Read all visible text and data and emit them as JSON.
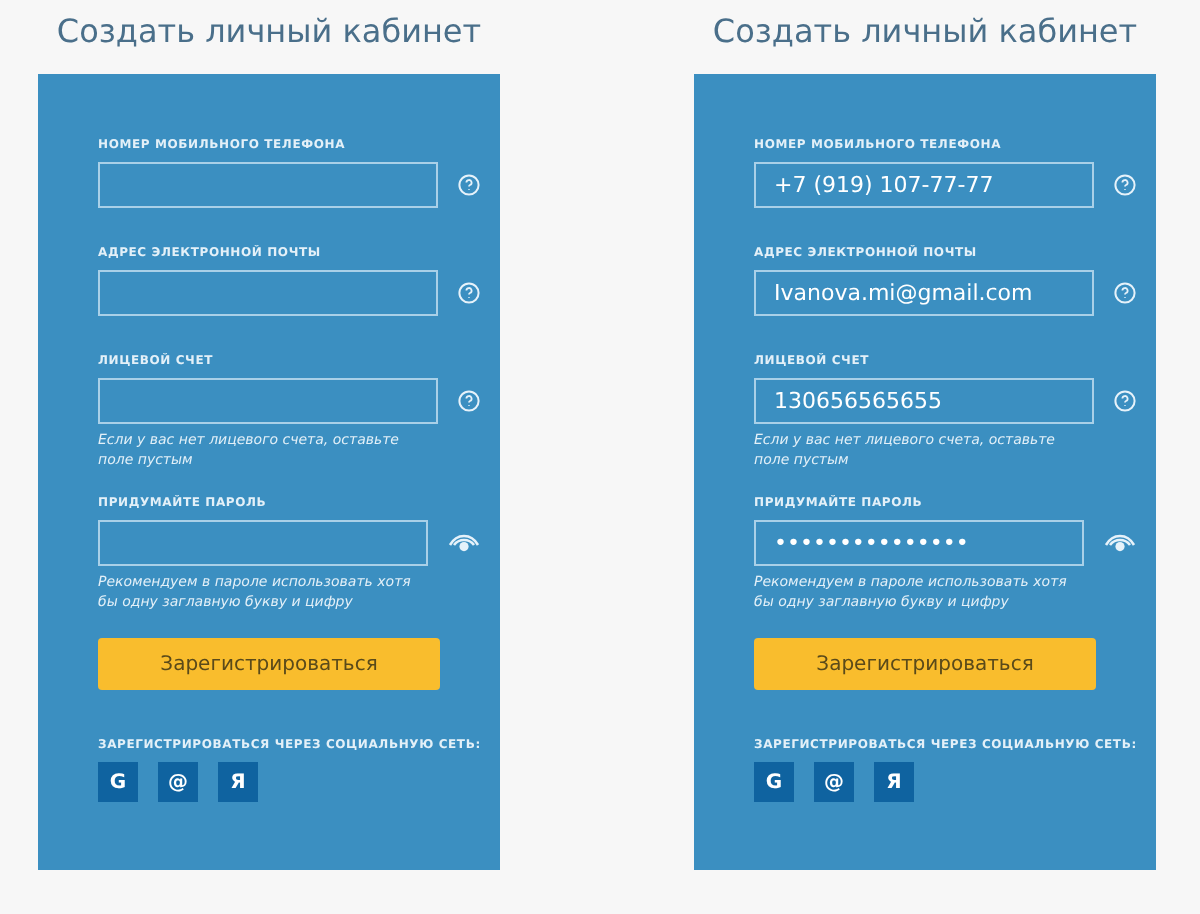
{
  "forms": [
    {
      "title": "Создать личный кабинет",
      "fields": [
        {
          "kind": "help",
          "label": "НОМЕР МОБИЛЬНОГО ТЕЛЕФОНА"
        },
        {
          "kind": "help",
          "label": "АДРЕС ЭЛЕКТРОННОЙ ПОЧТЫ"
        },
        {
          "kind": "help",
          "label": "ЛИЦЕВОЙ СЧЕТ",
          "hint": "Если у вас нет лицевого счета, оставьте поле пустым"
        },
        {
          "kind": "password",
          "label": "ПРИДУМАЙТЕ ПАРОЛЬ",
          "hint": "Рекомендуем в пароле использовать хотя бы одну заглавную букву и цифру"
        }
      ],
      "button": "Зарегистрироваться",
      "social_label": "ЗАРЕГИСТРИРОВАТЬСЯ ЧЕРЕЗ СОЦИАЛЬНУЮ СЕТЬ:",
      "social": [
        "G",
        "@",
        "Я"
      ]
    },
    {
      "title": "Создать личный кабинет",
      "fields": [
        {
          "kind": "help",
          "label": "НОМЕР МОБИЛЬНОГО ТЕЛЕФОНА",
          "value": "+7 (919) 107-77-77"
        },
        {
          "kind": "help",
          "label": "АДРЕС ЭЛЕКТРОННОЙ ПОЧТЫ",
          "value": "Ivanova.mi@gmail.com"
        },
        {
          "kind": "help",
          "label": "ЛИЦЕВОЙ СЧЕТ",
          "value": "130656565655",
          "hint": "Если у вас нет лицевого счета, оставьте поле пустым"
        },
        {
          "kind": "password",
          "label": "ПРИДУМАЙТЕ ПАРОЛЬ",
          "value": "•••••••••••••••",
          "hint": "Рекомендуем в пароле использовать хотя бы одну заглавную букву и цифру"
        }
      ],
      "button": "Зарегистрироваться",
      "social_label": "ЗАРЕГИСТРИРОВАТЬСЯ ЧЕРЕЗ СОЦИАЛЬНУЮ СЕТЬ:",
      "social": [
        "G",
        "@",
        "Я"
      ]
    }
  ]
}
